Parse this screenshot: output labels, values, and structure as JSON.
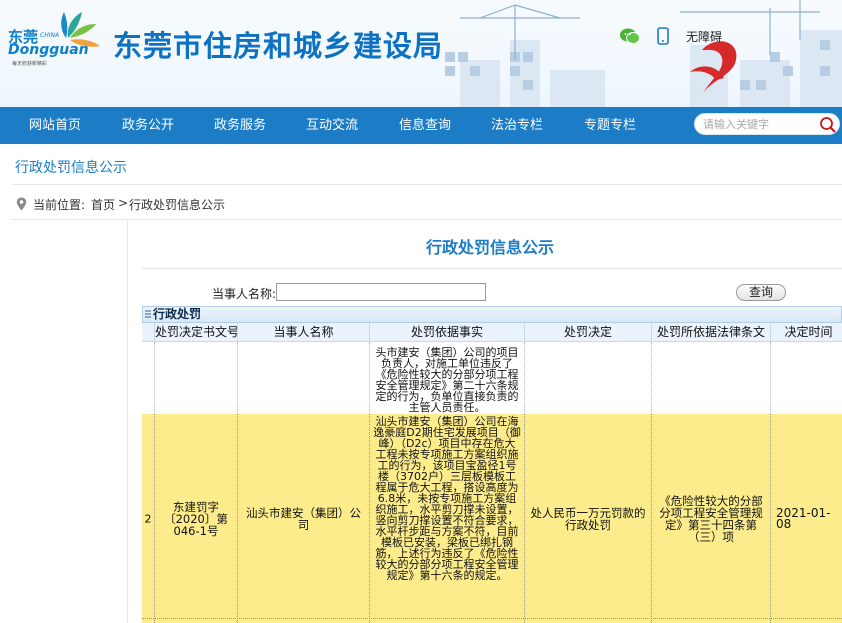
{
  "header": {
    "logo_cn": "东莞",
    "logo_china": "CHINA",
    "logo_en": "Dongguan",
    "logo_slogan": "每天收获新精彩",
    "site_title": "东莞市住房和城乡建设局",
    "accessibility_link": "无障碍",
    "accent_color": "#1d7cc6"
  },
  "nav": {
    "items": [
      "网站首页",
      "政务公开",
      "政务服务",
      "互动交流",
      "信息查询",
      "法治专栏",
      "专题专栏"
    ],
    "search_placeholder": "请输入关键字"
  },
  "page": {
    "heading": "行政处罚信息公示",
    "breadcrumb_label": "当前位置:",
    "breadcrumb_home": "首页",
    "breadcrumb_sep": ">",
    "breadcrumb_current": "行政处罚信息公示",
    "content_title": "行政处罚信息公示"
  },
  "query": {
    "label": "当事人名称:",
    "value": "",
    "button": "查询"
  },
  "grid": {
    "caption": "行政处罚",
    "columns": [
      "处罚决定书文号",
      "当事人名称",
      "处罚依据事实",
      "处罚决定",
      "处罚所依据法律条文",
      "决定时间"
    ],
    "rows": [
      {
        "index": "",
        "doc_no": "",
        "party": "",
        "facts": "头市建安（集团）公司的项目负责人，对施工单位违反了《危险性较大的分部分项工程安全管理规定》第二十六条规定的行为，负单位直接负责的主管人员责任。",
        "decision": "",
        "law": "",
        "date": ""
      },
      {
        "index": "2",
        "doc_no": "东建罚字〔2020〕第046-1号",
        "party": "汕头市建安（集团）公司",
        "facts": "汕头市建安（集团）公司在海逸豪庭D2期住宅发展项目（御峰）（D2c）项目中存在危大工程未按专项施工方案组织施工的行为，该项目宝盈径1号楼（3702户）三层板模板工程属于危大工程，搭设高度为6.8米，未按专项施工方案组织施工，水平剪刀撑未设置，竖向剪刀撑设置不符合要求，水平杆步距与方案不符，目前模板已安装，梁板已绑扎钢筋，上述行为违反了《危险性较大的分部分项工程安全管理规定》第十六条的规定。",
        "decision": "处人民币一万元罚款的行政处罚",
        "law": "《危险性较大的分部分项工程安全管理规定》第三十四条第（三）项",
        "date": "2021-01-08"
      }
    ]
  }
}
